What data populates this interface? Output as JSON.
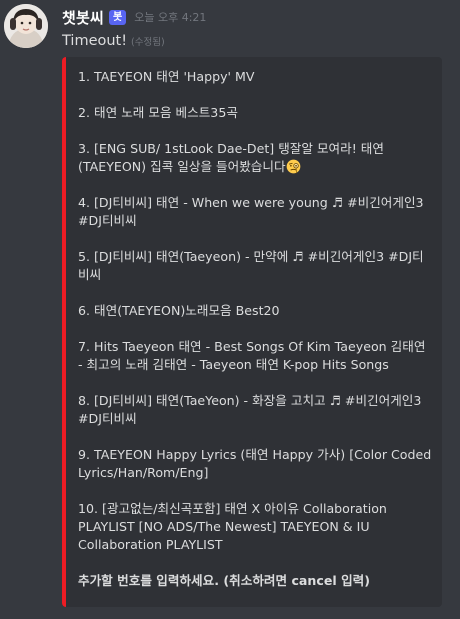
{
  "message": {
    "username": "챗봇씨",
    "bot_badge": "봇",
    "timestamp": "오늘 오후 4:21",
    "text": "Timeout!",
    "edited": "(수정됨)"
  },
  "embed": {
    "accent_color": "#ed1c24",
    "items": [
      "1. TAEYEON 태연 'Happy' MV",
      "2. 태연 노래 모음 베스트35곡",
      "3. [ENG SUB/ 1stLook Dae-Det] 탱잘알 모여라! 태연(TAEYEON) 집콕 일상을 들어봤습니다",
      "4. [DJ티비씨] 태연 - When we were young ♬ #비긴어게인3 #DJ티비씨",
      "5. [DJ티비씨] 태연(Taeyeon) - 만약에 ♬ #비긴어게인3 #DJ티비씨",
      "6. 태연(TAEYEON)노래모음 Best20",
      "7. Hits Taeyeon 태연 - Best Songs Of Kim Taeyeon 김태연 - 최고의 노래 김태연 - Taeyeon 태연 K-pop Hits Songs",
      "8. [DJ티비씨] 태연(TaeYeon) - 화장을 고치고 ♬ #비긴어게인3 #DJ티비씨",
      "9. TAEYEON Happy Lyrics (태연 Happy 가사) [Color Coded Lyrics/Han/Rom/Eng]",
      "10. [광고없는/최신곡포함] 태연 X 아이유 Collaboration PLAYLIST [NO ADS/The Newest] TAEYEON & IU Collaboration PLAYLIST"
    ],
    "item3_emoji": "face-with-monocle-icon",
    "footer": "추가할 번호를 입력하세요. (취소하려면 cancel 입력)"
  }
}
